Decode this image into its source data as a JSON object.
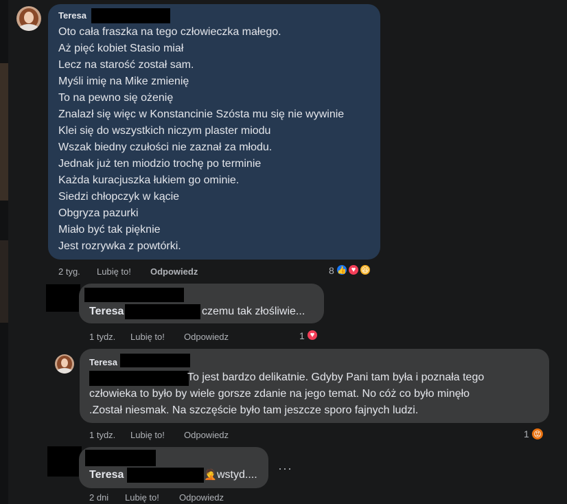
{
  "comment1": {
    "author": "Teresa",
    "lines": [
      "Oto cała fraszka na tego człowieczka małego.",
      "Aż pięć kobiet Stasio miał",
      "Lecz na starość został sam.",
      "Myśli imię na Mike zmienię",
      "To na pewno się ożenię",
      "Znalazł się więc w Konstancinie Szósta mu się nie wywinie",
      "Klei się do wszystkich niczym plaster miodu",
      "Wszak biedny czułości nie zaznał za młodu.",
      "Jednak już ten miodzio trochę po terminie",
      "Każda kuracjuszka łukiem go ominie.",
      "Siedzi chłopczyk w kącie",
      "Obgryza pazurki",
      "Miało być tak pięknie",
      "Jest rozrywka z powtórki."
    ],
    "time": "2 tyg.",
    "like_label": "Lubię to!",
    "reply_label": "Odpowiedz",
    "reaction_count": "8"
  },
  "comment2": {
    "mention": "Teresa",
    "text": "czemu tak złośliwie...",
    "time": "1 tydz.",
    "like_label": "Lubię to!",
    "reply_label": "Odpowiedz",
    "reaction_count": "1"
  },
  "comment3": {
    "author": "Teresa",
    "line1": "To jest bardzo delikatnie. Gdyby Pani tam była i poznała tego",
    "line2": "człowieka to było by wiele gorsze zdanie na jego temat. No cóż co było minęło",
    "line3": ".Został niesmak. Na szczęście było tam jeszcze sporo fajnych ludzi.",
    "time": "1 tydz.",
    "like_label": "Lubię to!",
    "reply_label": "Odpowiedz",
    "reaction_count": "1"
  },
  "comment4": {
    "mention": "Teresa",
    "emoji": "🤦",
    "text": "wstyd....",
    "time": "2 dni",
    "like_label": "Lubię to!",
    "reply_label": "Odpowiedz",
    "more": "···"
  },
  "colors": {
    "background": "#18191a",
    "bubble": "#3a3b3c",
    "main_bubble": "#263951",
    "text": "#e4e6eb",
    "meta": "#b0b3b8",
    "like": "#1877f2",
    "love": "#f33e58",
    "haha": "#f7b125",
    "angry": "#e9710f"
  },
  "icons": [
    "like-icon",
    "love-icon",
    "haha-icon",
    "angry-icon",
    "more-options-icon"
  ]
}
